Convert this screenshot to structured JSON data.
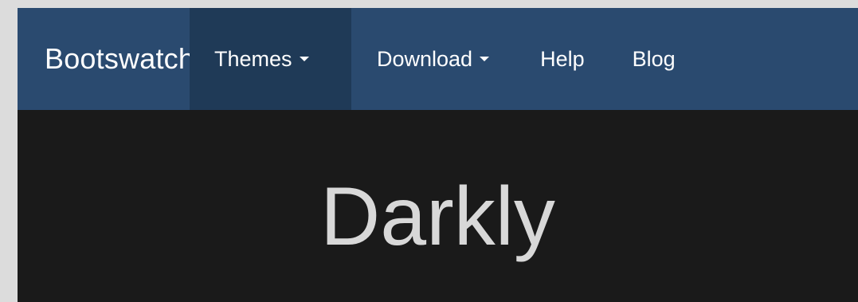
{
  "navbar": {
    "brand": "Bootswatch",
    "items": [
      {
        "label": "Themes",
        "dropdown": true,
        "active": true
      },
      {
        "label": "Download",
        "dropdown": true,
        "active": false
      },
      {
        "label": "Help",
        "dropdown": false,
        "active": false
      },
      {
        "label": "Blog",
        "dropdown": false,
        "active": false
      }
    ]
  },
  "hero": {
    "title": "Darkly"
  },
  "colors": {
    "navbar_bg": "#2a4a6f",
    "navbar_active_bg": "#1f3a57",
    "page_bg": "#1a1a1a",
    "title_color": "#d8d8d8"
  }
}
